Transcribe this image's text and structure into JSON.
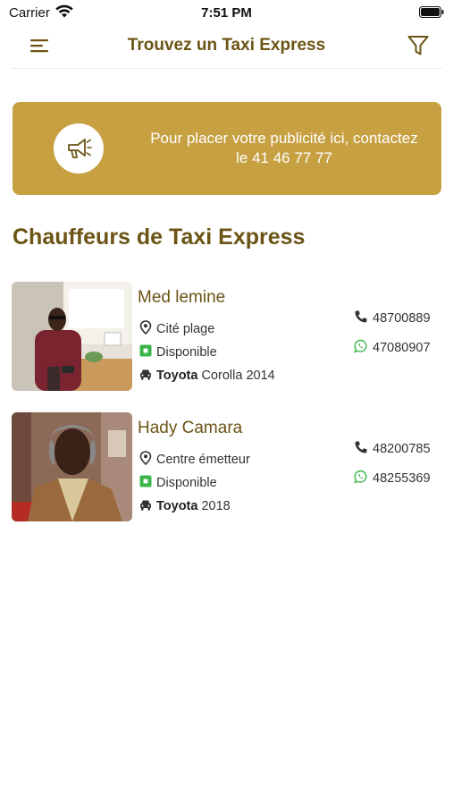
{
  "status_bar": {
    "carrier": "Carrier",
    "time": "7:51 PM"
  },
  "header": {
    "title": "Trouvez un Taxi Express",
    "menu_icon": "hamburger-menu-icon",
    "filter_icon": "filter-icon"
  },
  "ad_banner": {
    "text": "Pour placer votre publicité ici, contactez le 41 46 77 77",
    "icon": "megaphone-icon"
  },
  "section_title": "Chauffeurs de Taxi Express",
  "colors": {
    "brand_dark": "#6b5414",
    "brand_gold": "#c7a042",
    "status_available": "#3bb54a",
    "whatsapp": "#3bb54a"
  },
  "drivers": [
    {
      "name": "Med lemine",
      "location": "Cité plage",
      "status": "Disponible",
      "car_brand": "Toyota",
      "car_model": "Corolla 2014",
      "phone": "48700889",
      "whatsapp": "47080907"
    },
    {
      "name": "Hady Camara",
      "location": "Centre émetteur",
      "status": "Disponible",
      "car_brand": "Toyota",
      "car_model": "2018",
      "phone": "48200785",
      "whatsapp": "48255369"
    }
  ]
}
